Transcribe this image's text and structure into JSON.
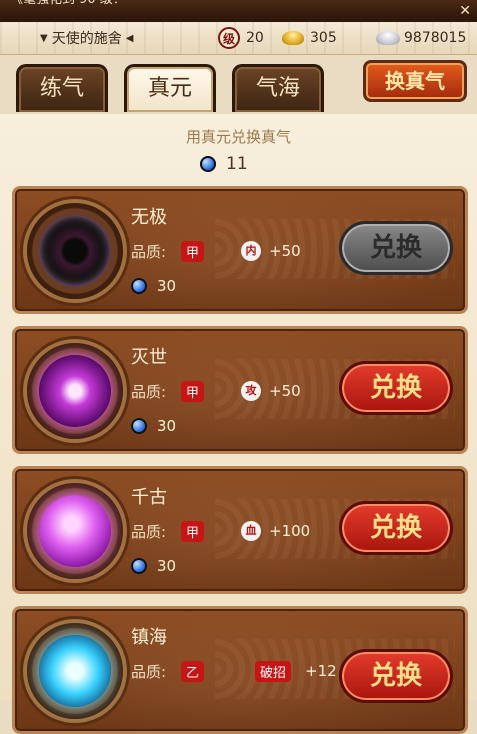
{
  "notice": {
    "text": "《毫强化到 90 级！",
    "close_icon": "close-icon"
  },
  "resources": {
    "server_name": "天使的施舍",
    "level_badge": "级",
    "level_value": "20",
    "gold": "305",
    "silver": "9878015"
  },
  "tabs": [
    {
      "label": "练气",
      "active": false
    },
    {
      "label": "真元",
      "active": true
    },
    {
      "label": "气海",
      "active": false
    }
  ],
  "exchange_qi_button": "换真气",
  "hint": "用真元兑换真气",
  "balance": "11",
  "quality_label": "品质:",
  "items": [
    {
      "name": "无极",
      "quality": "甲",
      "stat_icon": "内",
      "stat": "+50",
      "cost": "30",
      "button": "兑换",
      "button_state": "disabled",
      "emblem": "wuji"
    },
    {
      "name": "灭世",
      "quality": "甲",
      "stat_icon": "攻",
      "stat": "+50",
      "cost": "30",
      "button": "兑换",
      "button_state": "active",
      "emblem": "mieshi"
    },
    {
      "name": "千古",
      "quality": "甲",
      "stat_icon": "血",
      "stat": "+100",
      "cost": "30",
      "button": "兑换",
      "button_state": "active",
      "emblem": "qiangu"
    },
    {
      "name": "镇海",
      "quality": "乙",
      "stat_tag": "破招",
      "stat": "+12",
      "cost": "",
      "button": "兑换",
      "button_state": "active",
      "emblem": "zhenhai"
    }
  ],
  "colors": {
    "accent_red": "#c71414",
    "button_red": "#e43c2c",
    "card_brown": "#8e4e24",
    "text_cream": "#fff1d6"
  }
}
